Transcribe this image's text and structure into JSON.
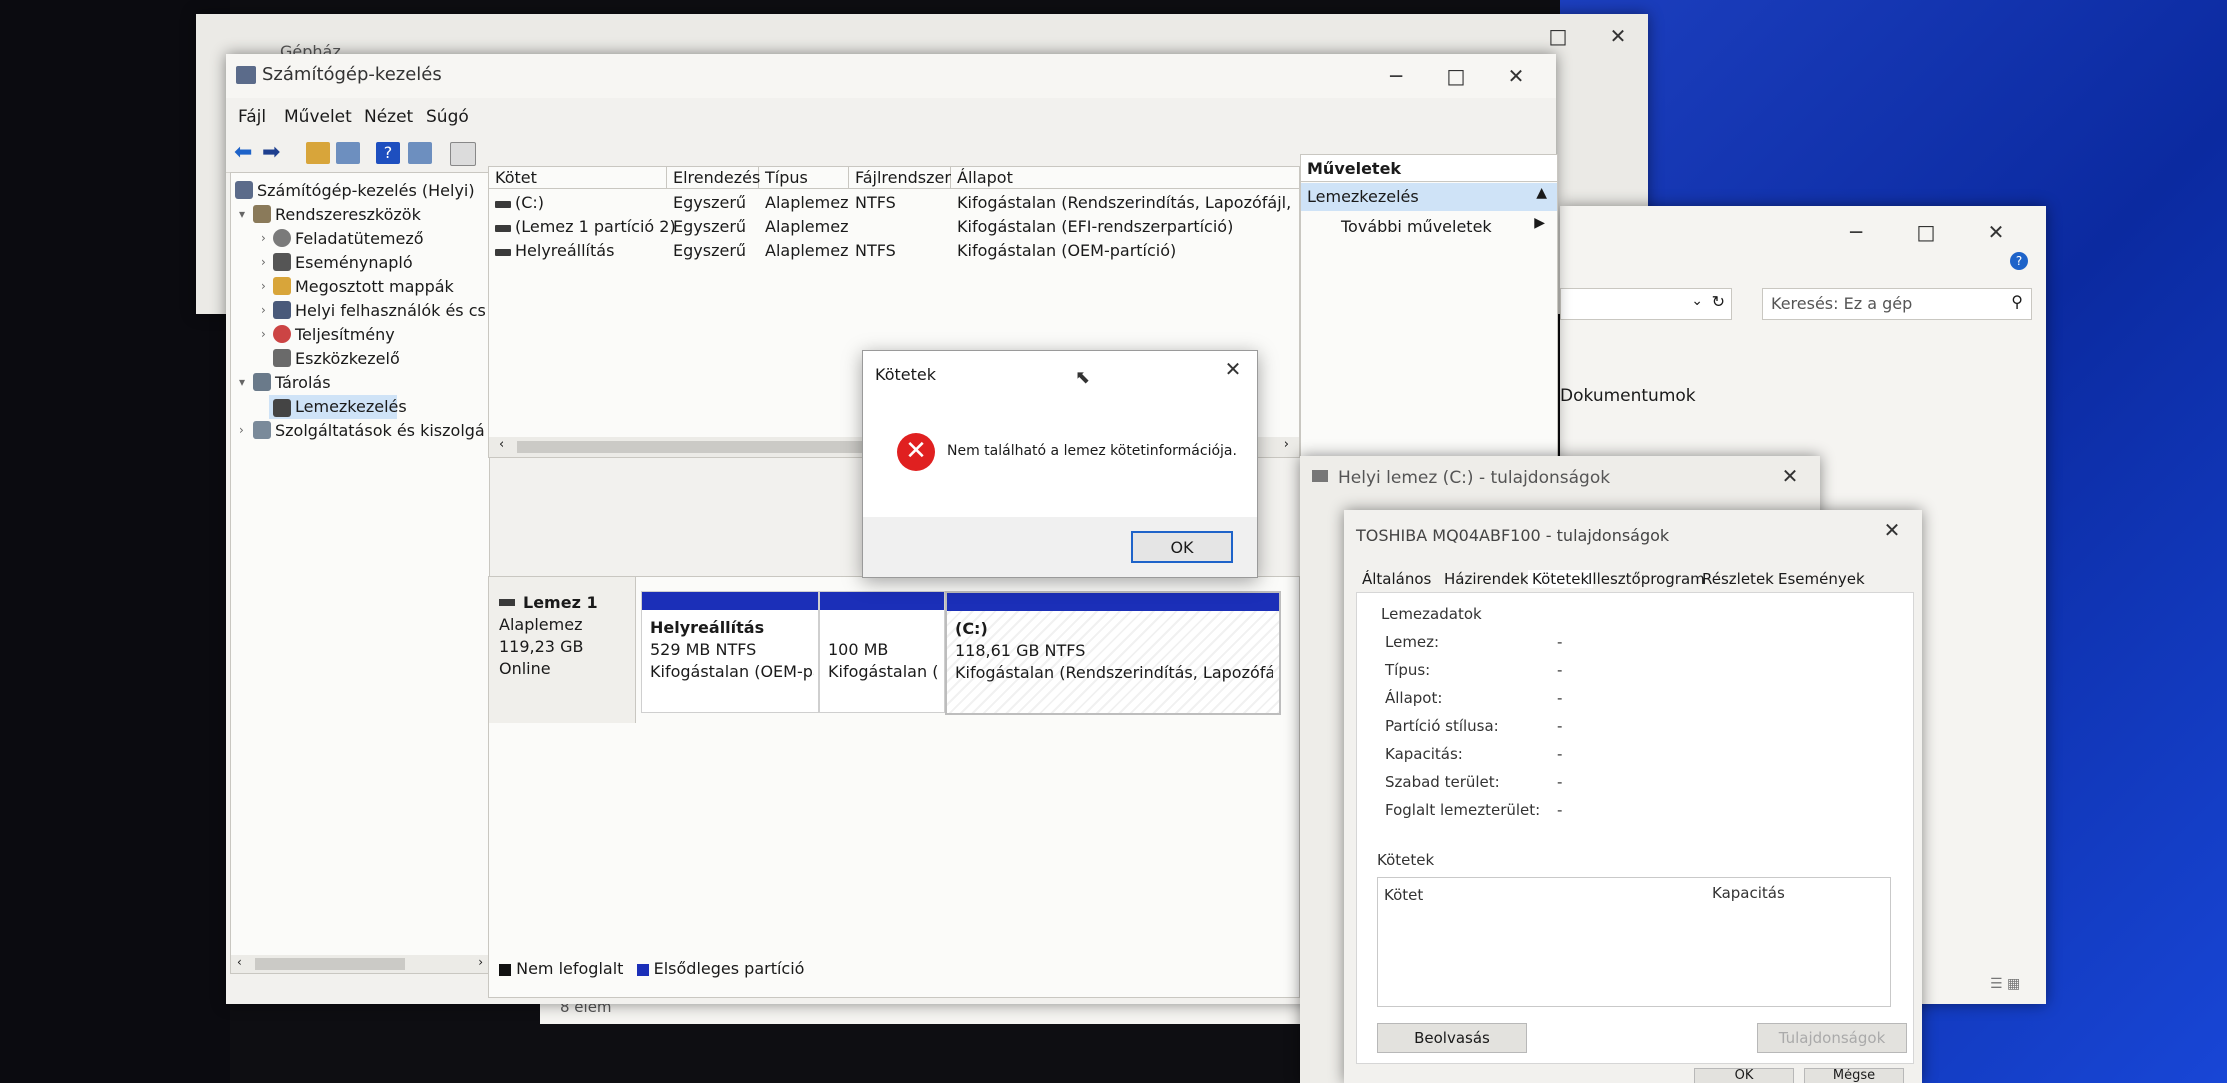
{
  "background_window": {
    "title": "Gépház"
  },
  "explorer": {
    "search_placeholder": "Keresés: Ez a gép",
    "item_documents": "Dokumentumok",
    "status_items": "8 elem"
  },
  "mmc": {
    "title": "Számítógép-kezelés",
    "menu": [
      "Fájl",
      "Művelet",
      "Nézet",
      "Súgó"
    ],
    "tree": {
      "root": "Számítógép-kezelés (Helyi)",
      "system_tools": "Rendszereszközök",
      "task_scheduler": "Feladatütemező",
      "event_viewer": "Eseménynapló",
      "shared_folders": "Megosztott mappák",
      "local_users": "Helyi felhasználók és cs",
      "performance": "Teljesítmény",
      "device_manager": "Eszközkezelő",
      "storage": "Tárolás",
      "disk_management": "Lemezkezelés",
      "services": "Szolgáltatások és kiszolgáló"
    },
    "columns": [
      "Kötet",
      "Elrendezés",
      "Típus",
      "Fájlrendszer",
      "Állapot"
    ],
    "volumes": [
      {
        "name": "(C:)",
        "layout": "Egyszerű",
        "type": "Alaplemez",
        "fs": "NTFS",
        "status": "Kifogástalan (Rendszerindítás, Lapozófájl, Össz"
      },
      {
        "name": "(Lemez 1 partíció 2)",
        "layout": "Egyszerű",
        "type": "Alaplemez",
        "fs": "",
        "status": "Kifogástalan (EFI-rendszerpartíció)"
      },
      {
        "name": "Helyreállítás",
        "layout": "Egyszerű",
        "type": "Alaplemez",
        "fs": "NTFS",
        "status": "Kifogástalan (OEM-partíció)"
      }
    ],
    "disk": {
      "name": "Lemez 1",
      "type": "Alaplemez",
      "size": "119,23 GB",
      "state": "Online",
      "partitions": [
        {
          "name": "Helyreállítás",
          "size": "529 MB NTFS",
          "status": "Kifogástalan (OEM-pa"
        },
        {
          "name": "",
          "size": "100 MB",
          "status": "Kifogástalan (EF"
        },
        {
          "name": "(C:)",
          "size": "118,61 GB NTFS",
          "status": "Kifogástalan (Rendszerindítás, Lapozófájl, Ös"
        }
      ]
    },
    "legend": {
      "unallocated": "Nem lefoglalt",
      "primary": "Elsődleges partíció"
    },
    "actions": {
      "header": "Műveletek",
      "section": "Lemezkezelés",
      "more": "További műveletek"
    }
  },
  "dialog": {
    "title": "Kötetek",
    "message": "Nem található a lemez kötetinformációja.",
    "ok": "OK"
  },
  "prop1": {
    "title": "Helyi lemez (C:) - tulajdonságok"
  },
  "prop2": {
    "title": "TOSHIBA MQ04ABF100 - tulajdonságok",
    "tabs": [
      "Általános",
      "Házirendek",
      "Kötetek",
      "Illesztőprogram",
      "Részletek",
      "Események"
    ],
    "group_disk": "Lemezadatok",
    "fields": [
      {
        "label": "Lemez:",
        "value": "-"
      },
      {
        "label": "Típus:",
        "value": "-"
      },
      {
        "label": "Állapot:",
        "value": "-"
      },
      {
        "label": "Partíció stílusa:",
        "value": "-"
      },
      {
        "label": "Kapacitás:",
        "value": "-"
      },
      {
        "label": "Szabad terület:",
        "value": "-"
      },
      {
        "label": "Foglalt lemezterület:",
        "value": "-"
      }
    ],
    "group_volumes": "Kötetek",
    "vol_columns": [
      "Kötet",
      "Kapacitás"
    ],
    "btn_scan": "Beolvasás",
    "btn_props": "Tulajdonságok",
    "btn_ok": "OK",
    "btn_cancel": "Mégse"
  },
  "colors": {
    "accent": "#1e63c9",
    "partition_bar": "#1b2fb8",
    "error": "#e02020"
  }
}
